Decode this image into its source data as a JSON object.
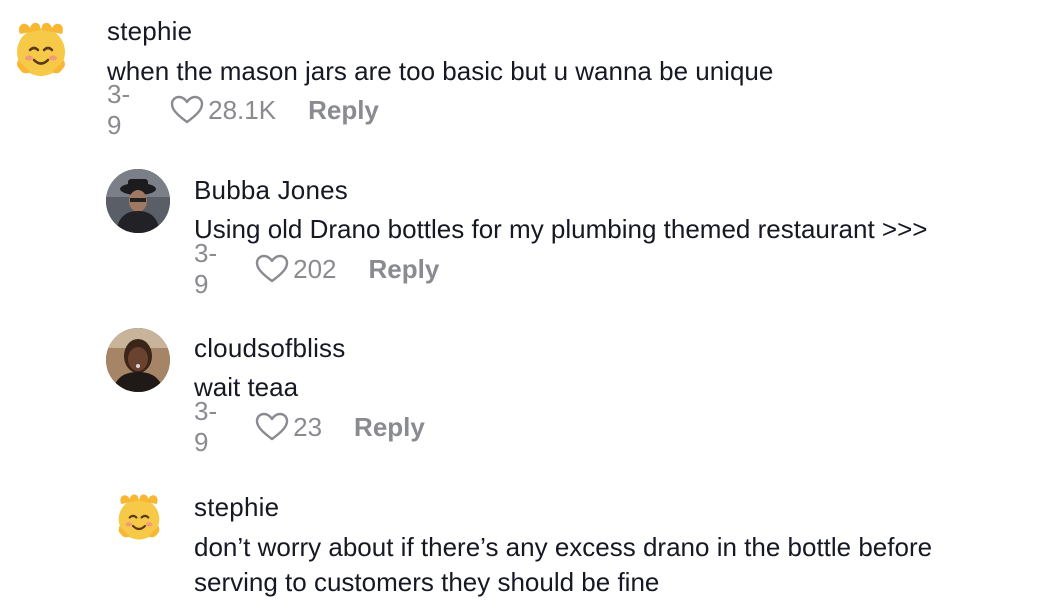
{
  "comments": [
    {
      "username": "stephie",
      "text_lines": [
        "when the mason jars are too basic but u wanna be unique"
      ],
      "date": "3-9",
      "likes": "28.1K",
      "reply_label": "Reply",
      "avatar": "smiling-face-emoji"
    },
    {
      "username": "Bubba Jones",
      "text_lines": [
        "Using old Drano bottles for my plumbing themed restaurant >>>"
      ],
      "date": "3-9",
      "likes": "202",
      "reply_label": "Reply",
      "avatar": "profile-photo"
    },
    {
      "username": "cloudsofbliss",
      "text_lines": [
        "wait teaa"
      ],
      "date": "3-9",
      "likes": "23",
      "reply_label": "Reply",
      "avatar": "profile-photo"
    },
    {
      "username": "stephie",
      "text_lines": [
        "don’t worry about if there’s any excess drano in the bottle before",
        "serving to customers they should be fine"
      ],
      "date": "",
      "likes": "",
      "reply_label": "",
      "avatar": "smiling-face-emoji"
    }
  ],
  "colors": {
    "text": "#161823",
    "muted": "#8a8b91",
    "emoji_face": "#f7c948"
  }
}
